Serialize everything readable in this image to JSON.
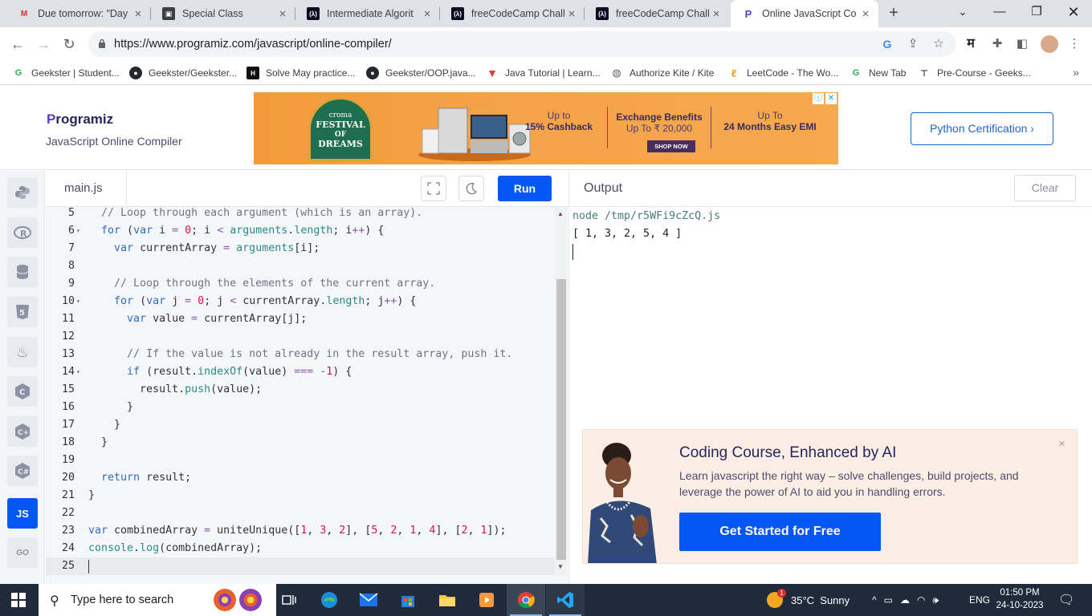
{
  "browser": {
    "tabs": [
      {
        "title": "Due tomorrow: \"Day",
        "favicon": "gmail-icon"
      },
      {
        "title": "Special Class",
        "favicon": "classroom-icon"
      },
      {
        "title": "Intermediate Algorit",
        "favicon": "freecodecamp-icon"
      },
      {
        "title": "freeCodeCamp Challe",
        "favicon": "freecodecamp-icon"
      },
      {
        "title": "freeCodeCamp Challe",
        "favicon": "freecodecamp-icon"
      },
      {
        "title": "Online JavaScript Co",
        "favicon": "programiz-icon",
        "active": true
      }
    ],
    "new_tab": "+",
    "url": "https://www.programiz.com/javascript/online-compiler/",
    "profile_letter": "म",
    "bookmarks": [
      {
        "label": "Geekster | Student...",
        "icon": "geekster-icon"
      },
      {
        "label": "Geekster/Geekster...",
        "icon": "github-icon"
      },
      {
        "label": "Solve May practice...",
        "icon": "hackerrank-icon"
      },
      {
        "label": "Geekster/OOP.java...",
        "icon": "github-icon"
      },
      {
        "label": "Java Tutorial | Learn...",
        "icon": "javatpoint-icon"
      },
      {
        "label": "Authorize Kite / Kite",
        "icon": "globe-icon"
      },
      {
        "label": "LeetCode - The Wo...",
        "icon": "leetcode-icon"
      },
      {
        "label": "New Tab",
        "icon": "geekster-icon"
      },
      {
        "label": "Pre-Course - Geeks...",
        "icon": "precourse-icon"
      }
    ],
    "bookmarks_more": "»"
  },
  "site": {
    "logo_p": "P",
    "logo_rest": "rogramiz",
    "subtitle": "JavaScript Online Compiler",
    "cert_button": "Python Certification ›",
    "ad": {
      "festival": [
        "croma",
        "FESTIVAL",
        "OF",
        "DREAMS"
      ],
      "offer1_line1": "Up to",
      "offer1_line2": "15% Cashback",
      "offer2_line1": "Exchange Benefits",
      "offer2_line2": "Up To ₹ 20,000",
      "offer3_line1": "Up To",
      "offer3_line2": "24 Months Easy EMI",
      "shop_now": "SHOP NOW"
    }
  },
  "languages": [
    {
      "name": "python-icon",
      "label": ""
    },
    {
      "name": "r-icon",
      "label": ""
    },
    {
      "name": "sql-icon",
      "label": ""
    },
    {
      "name": "html-icon",
      "label": ""
    },
    {
      "name": "java-icon",
      "label": ""
    },
    {
      "name": "c-icon",
      "label": ""
    },
    {
      "name": "cpp-icon",
      "label": ""
    },
    {
      "name": "csharp-icon",
      "label": ""
    },
    {
      "name": "js-icon",
      "label": "JS",
      "active": true
    },
    {
      "name": "go-icon",
      "label": "GO"
    }
  ],
  "editor": {
    "file_tab": "main.js",
    "run": "Run",
    "lines": [
      {
        "n": "5",
        "fold": false,
        "indent": 2,
        "tokens": [
          [
            "cm",
            "// Loop through each argument (which is an array)."
          ]
        ]
      },
      {
        "n": "6",
        "fold": true,
        "indent": 2,
        "tokens": [
          [
            "kw",
            "for"
          ],
          [
            "t",
            " ("
          ],
          [
            "kw",
            "var"
          ],
          [
            "t",
            " i "
          ],
          [
            "op",
            "="
          ],
          [
            "t",
            " "
          ],
          [
            "nm",
            "0"
          ],
          [
            "t",
            "; i "
          ],
          [
            "op",
            "<"
          ],
          [
            "t",
            " "
          ],
          [
            "pr",
            "arguments"
          ],
          [
            "t",
            "."
          ],
          [
            "pr",
            "length"
          ],
          [
            "t",
            "; i"
          ],
          [
            "op",
            "++"
          ],
          [
            "t",
            ") {"
          ]
        ]
      },
      {
        "n": "7",
        "fold": false,
        "indent": 4,
        "tokens": [
          [
            "kw",
            "var"
          ],
          [
            "t",
            " currentArray "
          ],
          [
            "op",
            "="
          ],
          [
            "t",
            " "
          ],
          [
            "pr",
            "arguments"
          ],
          [
            "t",
            "[i];"
          ]
        ]
      },
      {
        "n": "8",
        "fold": false,
        "indent": 0,
        "tokens": []
      },
      {
        "n": "9",
        "fold": false,
        "indent": 4,
        "tokens": [
          [
            "cm",
            "// Loop through the elements of the current array."
          ]
        ]
      },
      {
        "n": "10",
        "fold": true,
        "indent": 4,
        "tokens": [
          [
            "kw",
            "for"
          ],
          [
            "t",
            " ("
          ],
          [
            "kw",
            "var"
          ],
          [
            "t",
            " j "
          ],
          [
            "op",
            "="
          ],
          [
            "t",
            " "
          ],
          [
            "nm",
            "0"
          ],
          [
            "t",
            "; j "
          ],
          [
            "op",
            "<"
          ],
          [
            "t",
            " currentArray."
          ],
          [
            "pr",
            "length"
          ],
          [
            "t",
            "; j"
          ],
          [
            "op",
            "++"
          ],
          [
            "t",
            ") {"
          ]
        ]
      },
      {
        "n": "11",
        "fold": false,
        "indent": 6,
        "tokens": [
          [
            "kw",
            "var"
          ],
          [
            "t",
            " value "
          ],
          [
            "op",
            "="
          ],
          [
            "t",
            " currentArray[j];"
          ]
        ]
      },
      {
        "n": "12",
        "fold": false,
        "indent": 0,
        "tokens": []
      },
      {
        "n": "13",
        "fold": false,
        "indent": 6,
        "tokens": [
          [
            "cm",
            "// If the value is not already in the result array, push it."
          ]
        ]
      },
      {
        "n": "14",
        "fold": true,
        "indent": 6,
        "tokens": [
          [
            "kw",
            "if"
          ],
          [
            "t",
            " (result."
          ],
          [
            "pr",
            "indexOf"
          ],
          [
            "t",
            "(value) "
          ],
          [
            "op",
            "==="
          ],
          [
            "t",
            " "
          ],
          [
            "op",
            "-"
          ],
          [
            "nm",
            "1"
          ],
          [
            "t",
            ") {"
          ]
        ]
      },
      {
        "n": "15",
        "fold": false,
        "indent": 8,
        "tokens": [
          [
            "t",
            "result."
          ],
          [
            "pr",
            "push"
          ],
          [
            "t",
            "(value);"
          ]
        ]
      },
      {
        "n": "16",
        "fold": false,
        "indent": 6,
        "tokens": [
          [
            "t",
            "}"
          ]
        ]
      },
      {
        "n": "17",
        "fold": false,
        "indent": 4,
        "tokens": [
          [
            "t",
            "}"
          ]
        ]
      },
      {
        "n": "18",
        "fold": false,
        "indent": 2,
        "tokens": [
          [
            "t",
            "}"
          ]
        ]
      },
      {
        "n": "19",
        "fold": false,
        "indent": 0,
        "tokens": []
      },
      {
        "n": "20",
        "fold": false,
        "indent": 2,
        "tokens": [
          [
            "kw",
            "return"
          ],
          [
            "t",
            " result;"
          ]
        ]
      },
      {
        "n": "21",
        "fold": false,
        "indent": 0,
        "tokens": [
          [
            "t",
            "}"
          ]
        ]
      },
      {
        "n": "22",
        "fold": false,
        "indent": 0,
        "tokens": []
      },
      {
        "n": "23",
        "fold": false,
        "indent": 0,
        "tokens": [
          [
            "kw",
            "var"
          ],
          [
            "t",
            " combinedArray "
          ],
          [
            "op",
            "="
          ],
          [
            "t",
            " uniteUnique(["
          ],
          [
            "nm",
            "1"
          ],
          [
            "t",
            ", "
          ],
          [
            "nm",
            "3"
          ],
          [
            "t",
            ", "
          ],
          [
            "nm",
            "2"
          ],
          [
            "t",
            "], ["
          ],
          [
            "nm",
            "5"
          ],
          [
            "t",
            ", "
          ],
          [
            "nm",
            "2"
          ],
          [
            "t",
            ", "
          ],
          [
            "nm",
            "1"
          ],
          [
            "t",
            ", "
          ],
          [
            "nm",
            "4"
          ],
          [
            "t",
            "], ["
          ],
          [
            "nm",
            "2"
          ],
          [
            "t",
            ", "
          ],
          [
            "nm",
            "1"
          ],
          [
            "t",
            "]);"
          ]
        ]
      },
      {
        "n": "24",
        "fold": false,
        "indent": 0,
        "tokens": [
          [
            "pr",
            "console"
          ],
          [
            "t",
            "."
          ],
          [
            "pr",
            "log"
          ],
          [
            "t",
            "(combinedArray);"
          ]
        ]
      },
      {
        "n": "25",
        "fold": false,
        "indent": 0,
        "tokens": [],
        "current": true
      }
    ]
  },
  "output": {
    "title": "Output",
    "clear": "Clear",
    "command": "node /tmp/r5WFi9cZcQ.js",
    "result": "[ 1, 3, 2, 5, 4 ]",
    "promo": {
      "title": "Coding Course, Enhanced by AI",
      "body": "Learn javascript the right way – solve challenges, build projects, and leverage the power of AI to aid you in handling errors.",
      "cta": "Get Started for Free",
      "close": "×"
    }
  },
  "taskbar": {
    "search_placeholder": "Type here to search",
    "weather": "35°C  Sunny",
    "weather_badge": "1",
    "language": "ENG",
    "time": "01:50 PM",
    "date": "24-10-2023"
  },
  "colors": {
    "accent": "#0556f3",
    "cert_border": "#2563c9",
    "taskbar": "#1f2b3a"
  }
}
